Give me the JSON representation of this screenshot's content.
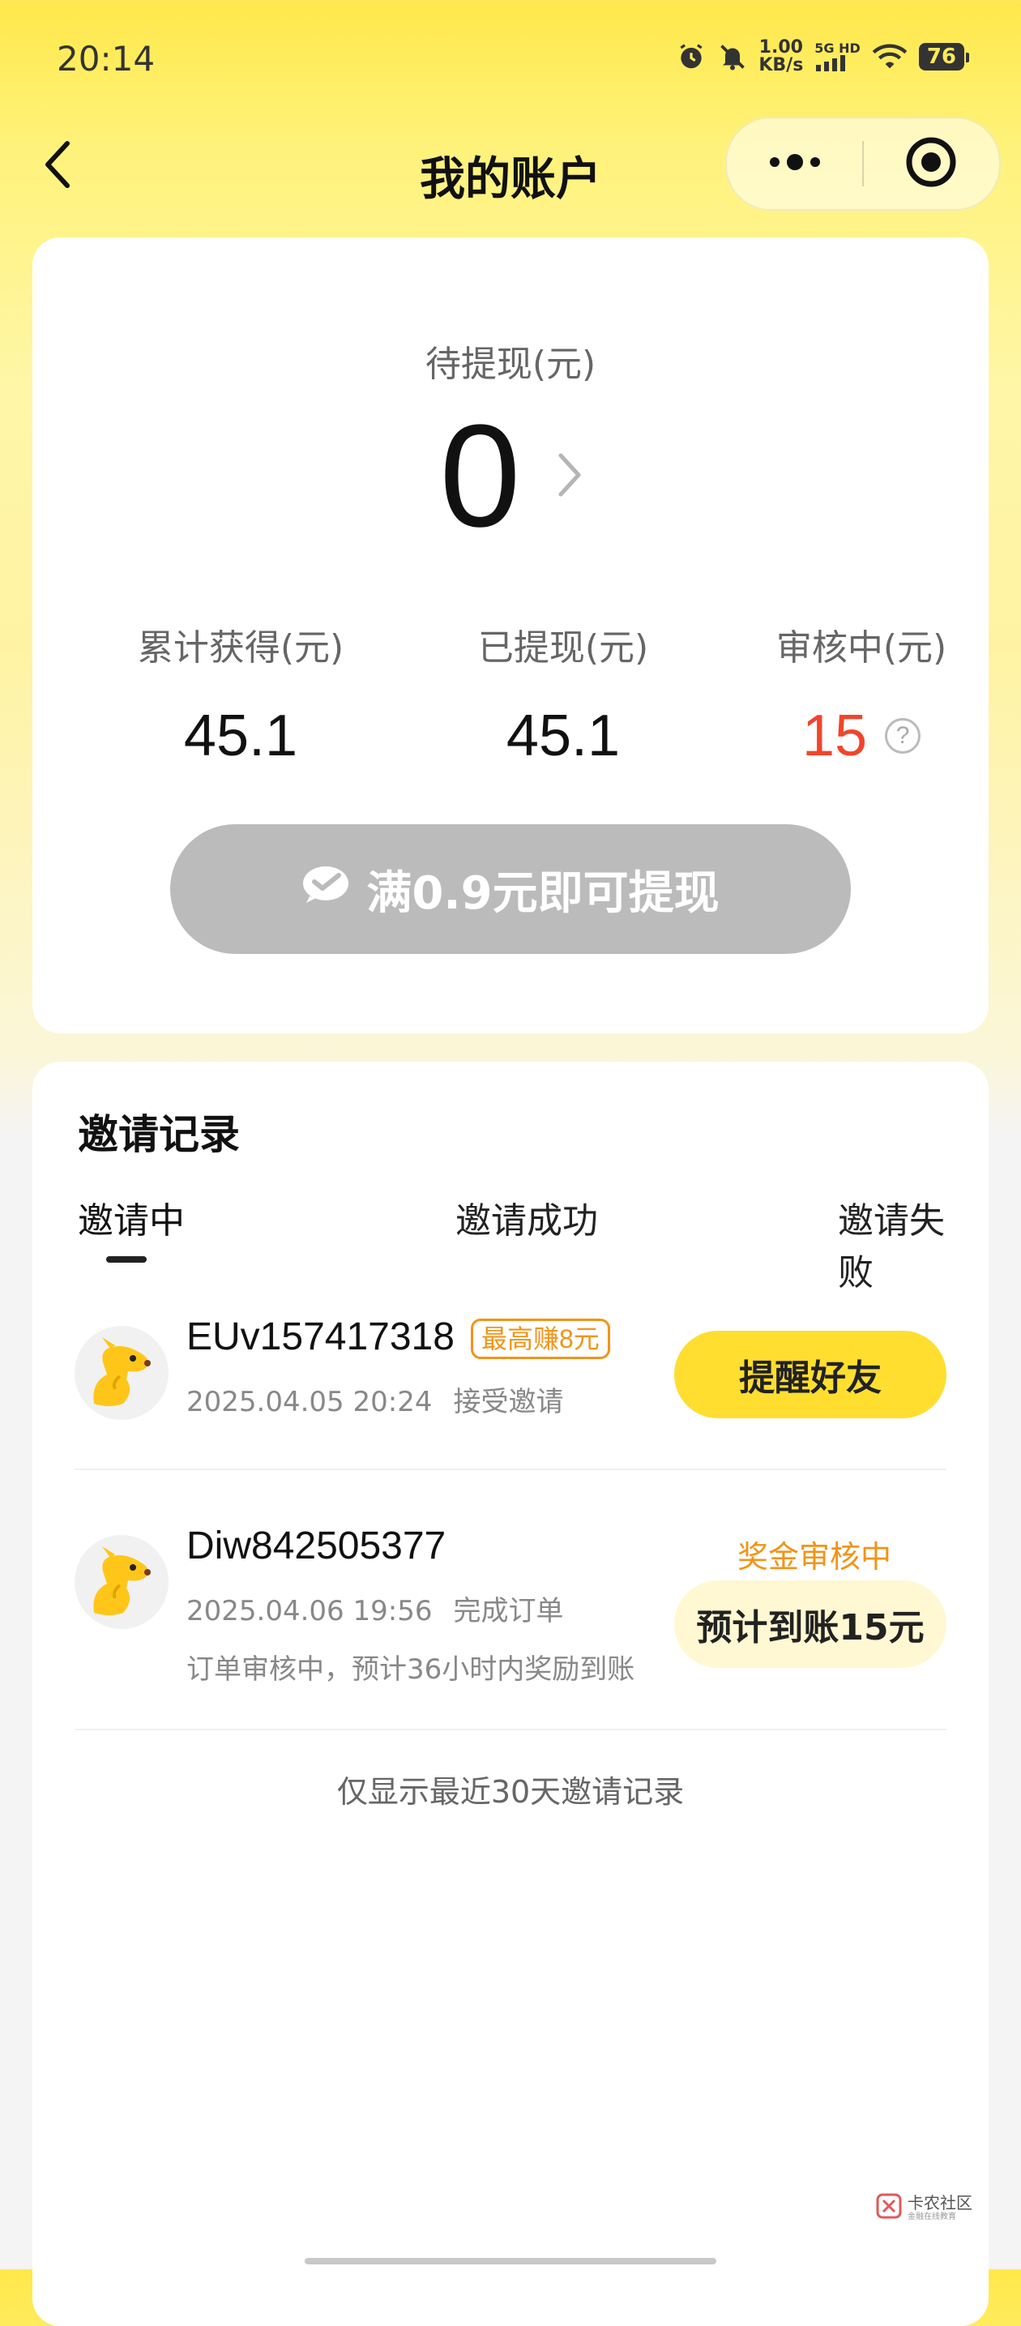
{
  "status_bar": {
    "time": "20:14",
    "net_speed_value": "1.00",
    "net_speed_unit": "KB/s",
    "signal_label": "5G HD",
    "battery": "76",
    "icons": [
      "alarm-icon",
      "mute-icon",
      "signal-icon",
      "wifi-icon",
      "battery-icon"
    ]
  },
  "nav": {
    "title": "我的账户",
    "icons": [
      "back-icon",
      "more-icon",
      "close-target-icon"
    ]
  },
  "balance": {
    "pending_label": "待提现(元)",
    "pending_value": "0",
    "stats": [
      {
        "label": "累计获得(元)",
        "value": "45.1"
      },
      {
        "label": "已提现(元)",
        "value": "45.1"
      },
      {
        "label": "审核中(元)",
        "value": "15"
      }
    ],
    "help_symbol": "?",
    "withdraw_button": "满0.9元即可提现",
    "colors": {
      "highlight": "#f0452c",
      "button_disabled": "#bbbbbb"
    }
  },
  "invite": {
    "title": "邀请记录",
    "tabs": [
      "邀请中",
      "邀请成功",
      "邀请失败"
    ],
    "active_tab": "邀请中",
    "records": [
      {
        "name": "EUv157417318",
        "tag": "最高赚8元",
        "time": "2025.04.05 20:24",
        "status": "接受邀请",
        "action": "提醒好友"
      },
      {
        "name": "Diw842505377",
        "time": "2025.04.06 19:56",
        "status": "完成订单",
        "note": "订单审核中，预计36小时内奖励到账",
        "reward_status": "奖金审核中",
        "expected": "预计到账15元"
      }
    ],
    "footer": "仅显示最近30天邀请记录",
    "colors": {
      "accent": "#ffde2f",
      "orange": "#f29417"
    }
  },
  "watermark": {
    "main": "卡农社区",
    "sub": "金融在线教育"
  },
  "theme": {
    "background_top": "#ffe84a"
  }
}
